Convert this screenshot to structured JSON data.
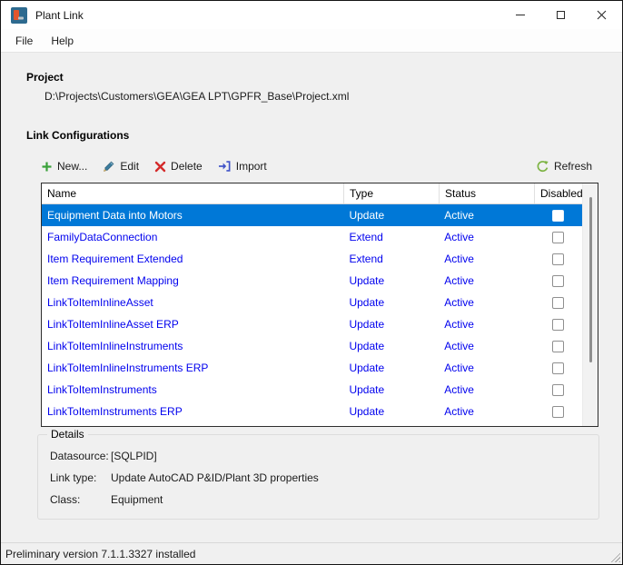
{
  "window": {
    "title": "Plant Link",
    "controls": {
      "minimize": "minimize",
      "maximize": "maximize",
      "close": "close"
    }
  },
  "menu": {
    "items": [
      {
        "label": "File"
      },
      {
        "label": "Help"
      }
    ]
  },
  "project": {
    "heading": "Project",
    "path": "D:\\Projects\\Customers\\GEA\\GEA LPT\\GPFR_Base\\Project.xml"
  },
  "link_configurations": {
    "heading": "Link Configurations",
    "toolbar": {
      "new_label": "New...",
      "edit_label": "Edit",
      "delete_label": "Delete",
      "import_label": "Import",
      "refresh_label": "Refresh"
    },
    "table": {
      "columns": [
        "Name",
        "Type",
        "Status",
        "Disabled"
      ],
      "rows": [
        {
          "name": "Equipment Data into Motors",
          "type": "Update",
          "status": "Active",
          "disabled": false,
          "selected": true
        },
        {
          "name": "FamilyDataConnection",
          "type": "Extend",
          "status": "Active",
          "disabled": false,
          "selected": false
        },
        {
          "name": "Item Requirement Extended",
          "type": "Extend",
          "status": "Active",
          "disabled": false,
          "selected": false
        },
        {
          "name": "Item Requirement Mapping",
          "type": "Update",
          "status": "Active",
          "disabled": false,
          "selected": false
        },
        {
          "name": "LinkToItemInlineAsset",
          "type": "Update",
          "status": "Active",
          "disabled": false,
          "selected": false
        },
        {
          "name": "LinkToItemInlineAsset ERP",
          "type": "Update",
          "status": "Active",
          "disabled": false,
          "selected": false
        },
        {
          "name": "LinkToItemInlineInstruments",
          "type": "Update",
          "status": "Active",
          "disabled": false,
          "selected": false
        },
        {
          "name": "LinkToItemInlineInstruments ERP",
          "type": "Update",
          "status": "Active",
          "disabled": false,
          "selected": false
        },
        {
          "name": "LinkToItemInstruments",
          "type": "Update",
          "status": "Active",
          "disabled": false,
          "selected": false
        },
        {
          "name": "LinkToItemInstruments ERP",
          "type": "Update",
          "status": "Active",
          "disabled": false,
          "selected": false
        }
      ],
      "partial_row_visible": true
    }
  },
  "details": {
    "heading": "Details",
    "fields": [
      {
        "label": "Datasource:",
        "value": "[SQLPID]"
      },
      {
        "label": "Link type:",
        "value": "Update AutoCAD P&ID/Plant 3D properties"
      },
      {
        "label": "Class:",
        "value": "Equipment"
      }
    ]
  },
  "status_bar": {
    "text": "Preliminary version 7.1.1.3327 installed"
  },
  "icons": {
    "app": "plant-link-app-icon",
    "new": "plus-icon",
    "edit": "pencil-icon",
    "delete": "red-x-icon",
    "import": "import-arrow-icon",
    "refresh": "refresh-circular-arrow-icon"
  },
  "colors": {
    "selection_background": "#0078d7",
    "selection_text": "#ffffff",
    "row_link_text": "#0000ee",
    "new_icon_green": "#3aa13a",
    "delete_icon_red": "#d42a2a",
    "import_icon_blue": "#4053c8",
    "refresh_icon_green": "#7cb342",
    "app_icon_blue": "#2d6a8f",
    "app_icon_orange": "#e2562e"
  }
}
